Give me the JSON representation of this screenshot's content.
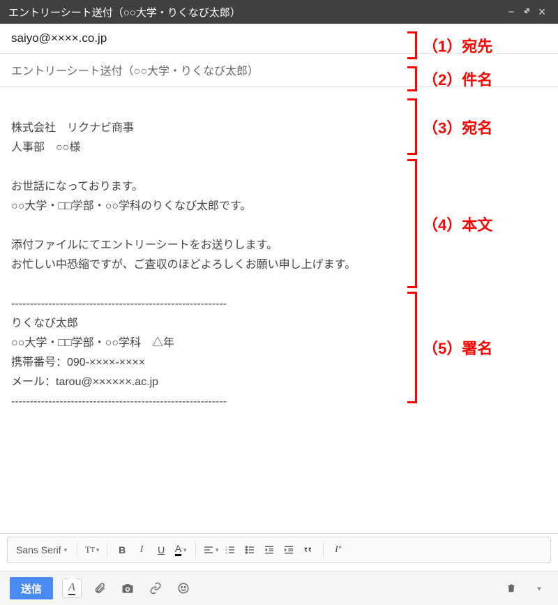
{
  "window": {
    "title": "エントリーシート送付（○○大学・りくなび太郎）"
  },
  "email": {
    "to": "saiyo@××××.co.jp",
    "subject": "エントリーシート送付（○○大学・りくなび太郎）",
    "body": "株式会社　リクナビ商事\n人事部　○○様\n\nお世話になっております。\n○○大学・□□学部・○○学科のりくなび太郎です。\n\n添付ファイルにてエントリーシートをお送りします。\nお忙しい中恐縮ですが、ご査収のほどよろしくお願い申し上げます。\n\n----------------------------------------------------------\nりくなび太郎\n○○大学・□□学部・○○学科　△年\n携帯番号：090-××××-××××\nメール：tarou@××××××.ac.jp\n----------------------------------------------------------"
  },
  "annotations": {
    "a1": "（1）宛先",
    "a2": "（2）件名",
    "a3": "（3）宛名",
    "a4": "（4）本文",
    "a5": "（5）署名"
  },
  "format_toolbar": {
    "font": "Sans Serif"
  },
  "bottom": {
    "send": "送信"
  }
}
